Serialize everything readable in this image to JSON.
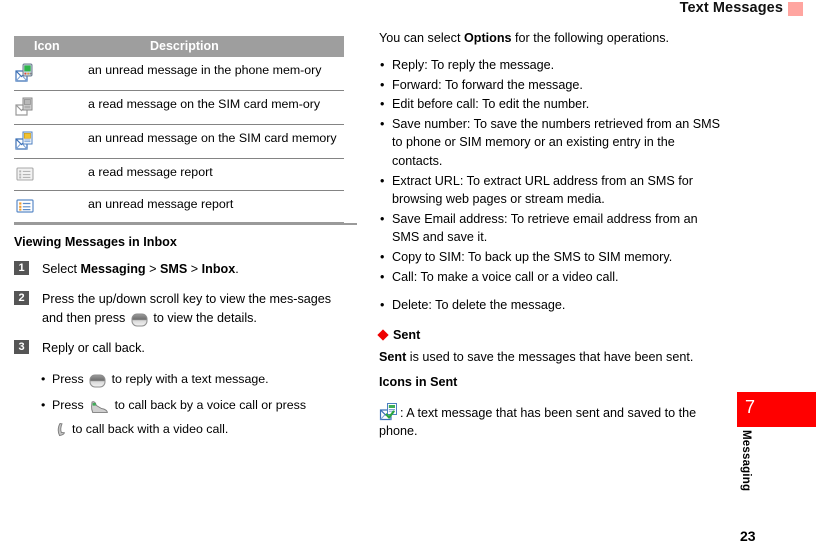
{
  "header": {
    "title": "Text Messages",
    "swatch_color": "#ffa5a0"
  },
  "left_column": {
    "table": {
      "headers": [
        "Icon",
        "Description"
      ],
      "header_bg": "#9e9e9e",
      "rows": [
        {
          "icon": "unread-message-phone-memory-icon",
          "description": "an unread message in the phone mem-ory"
        },
        {
          "icon": "read-message-sim-card-icon",
          "description": "a read message on the SIM card mem-ory"
        },
        {
          "icon": "unread-message-sim-card-icon",
          "description": "an unread message on the SIM card memory"
        },
        {
          "icon": "read-message-report-icon",
          "description": "a read message report"
        },
        {
          "icon": "unread-message-report-icon",
          "description": "an unread message report"
        }
      ]
    },
    "section_title": "Viewing Messages in Inbox",
    "steps": [
      {
        "num": "1",
        "parts": [
          {
            "t": "Select ",
            "b": false
          },
          {
            "t": "Messaging",
            "b": true
          },
          {
            "t": " > ",
            "b": false
          },
          {
            "t": "SMS",
            "b": true
          },
          {
            "t": " > ",
            "b": false
          },
          {
            "t": "Inbox",
            "b": true
          },
          {
            "t": ".",
            "b": false
          }
        ]
      },
      {
        "num": "2",
        "text_before": "Press the up/down scroll key to view the mes-sages and then press ",
        "icon": "ok-key-icon",
        "text_after": " to view the details."
      },
      {
        "num": "3",
        "text": "Reply or call back."
      }
    ],
    "sub_bullets": [
      {
        "before": "Press ",
        "icon": "ok-key-icon",
        "after": " to reply with a text message."
      },
      {
        "before": "Press ",
        "icon": "voice-call-key-icon",
        "middle": " to call back by a voice call or press ",
        "icon2": "video-call-key-icon",
        "after": "to call back with a video call."
      }
    ]
  },
  "right_column": {
    "intro": {
      "before": "You can select ",
      "bold": "Options",
      "after": " for the following operations."
    },
    "operations": [
      "Reply: To reply the message.",
      "Forward: To forward the message.",
      "Edit before call: To edit the number.",
      "Save number: To save the numbers retrieved from an SMS to phone or SIM memory or an existing entry in the contacts.",
      "Extract URL: To extract URL address from an SMS for browsing web pages or stream media.",
      "Save Email address: To retrieve email address from an SMS and save it.",
      "Copy to SIM: To back up the SMS to SIM memory.",
      "Call: To make a voice call or a video call.",
      "Delete: To delete the message."
    ],
    "sent_section": {
      "heading": "Sent",
      "diamond_color": "#ee0000",
      "paragraph_bold": "Sent",
      "paragraph_rest": " is used to save the messages that have been sent.",
      "icons_heading": "Icons in Sent",
      "icon_name": "sent-message-saved-phone-icon",
      "icon_description": ": A text message that has been sent and saved to the phone."
    }
  },
  "side_tab": {
    "number": "7",
    "label": "Messaging",
    "color": "#ff0000"
  },
  "footer": {
    "page_number": "23"
  }
}
